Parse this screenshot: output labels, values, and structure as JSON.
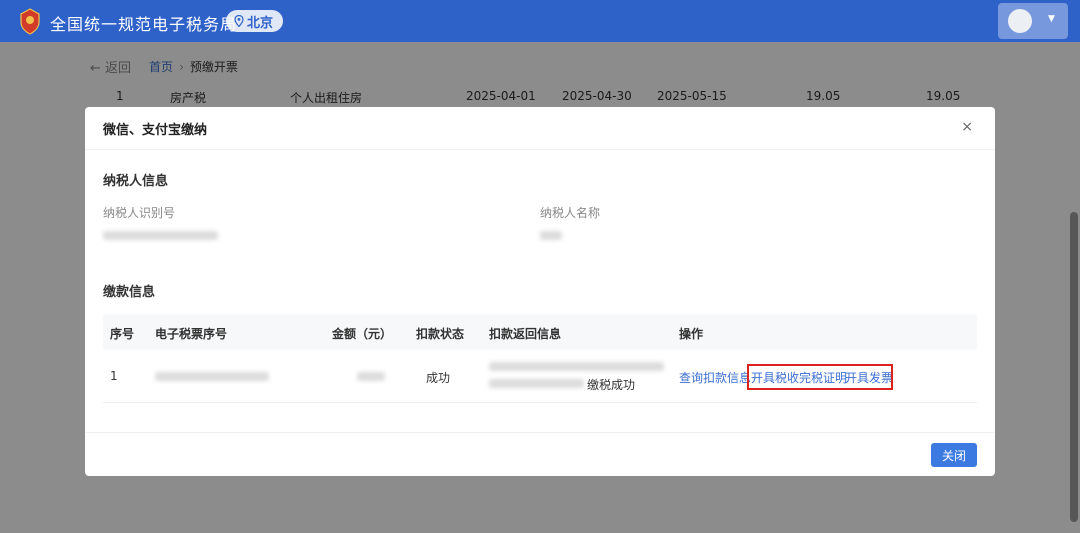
{
  "header": {
    "title": "全国统一规范电子税务局",
    "region": "北京"
  },
  "breadcrumb": {
    "back": "返回",
    "home": "首页",
    "sep": "›",
    "current": "预缴开票"
  },
  "background_row": [
    "1",
    "房产税",
    "个人出租住房",
    "2025-04-01",
    "2025-04-30",
    "2025-05-15",
    "19.05",
    "19.05"
  ],
  "modal": {
    "title": "微信、支付宝缴纳",
    "close_icon": "×",
    "taxpayer_section": "纳税人信息",
    "taxpayer_id_label": "纳税人识别号",
    "taxpayer_name_label": "纳税人名称",
    "payment_section": "缴款信息",
    "columns": [
      "序号",
      "电子税票序号",
      "金额（元）",
      "扣款状态",
      "扣款返回信息",
      "操作"
    ],
    "row": {
      "index": "1",
      "status": "成功",
      "return_msg_tail": "缴税成功",
      "actions": [
        "查询扣款信息",
        "开具税收完税证明",
        "开具发票"
      ]
    },
    "close_button": "关闭"
  },
  "colors": {
    "header_bg": "#2e62c9",
    "link": "#3b6fd0",
    "highlight": "#d9241e",
    "primary_button": "#3b7ae0"
  }
}
